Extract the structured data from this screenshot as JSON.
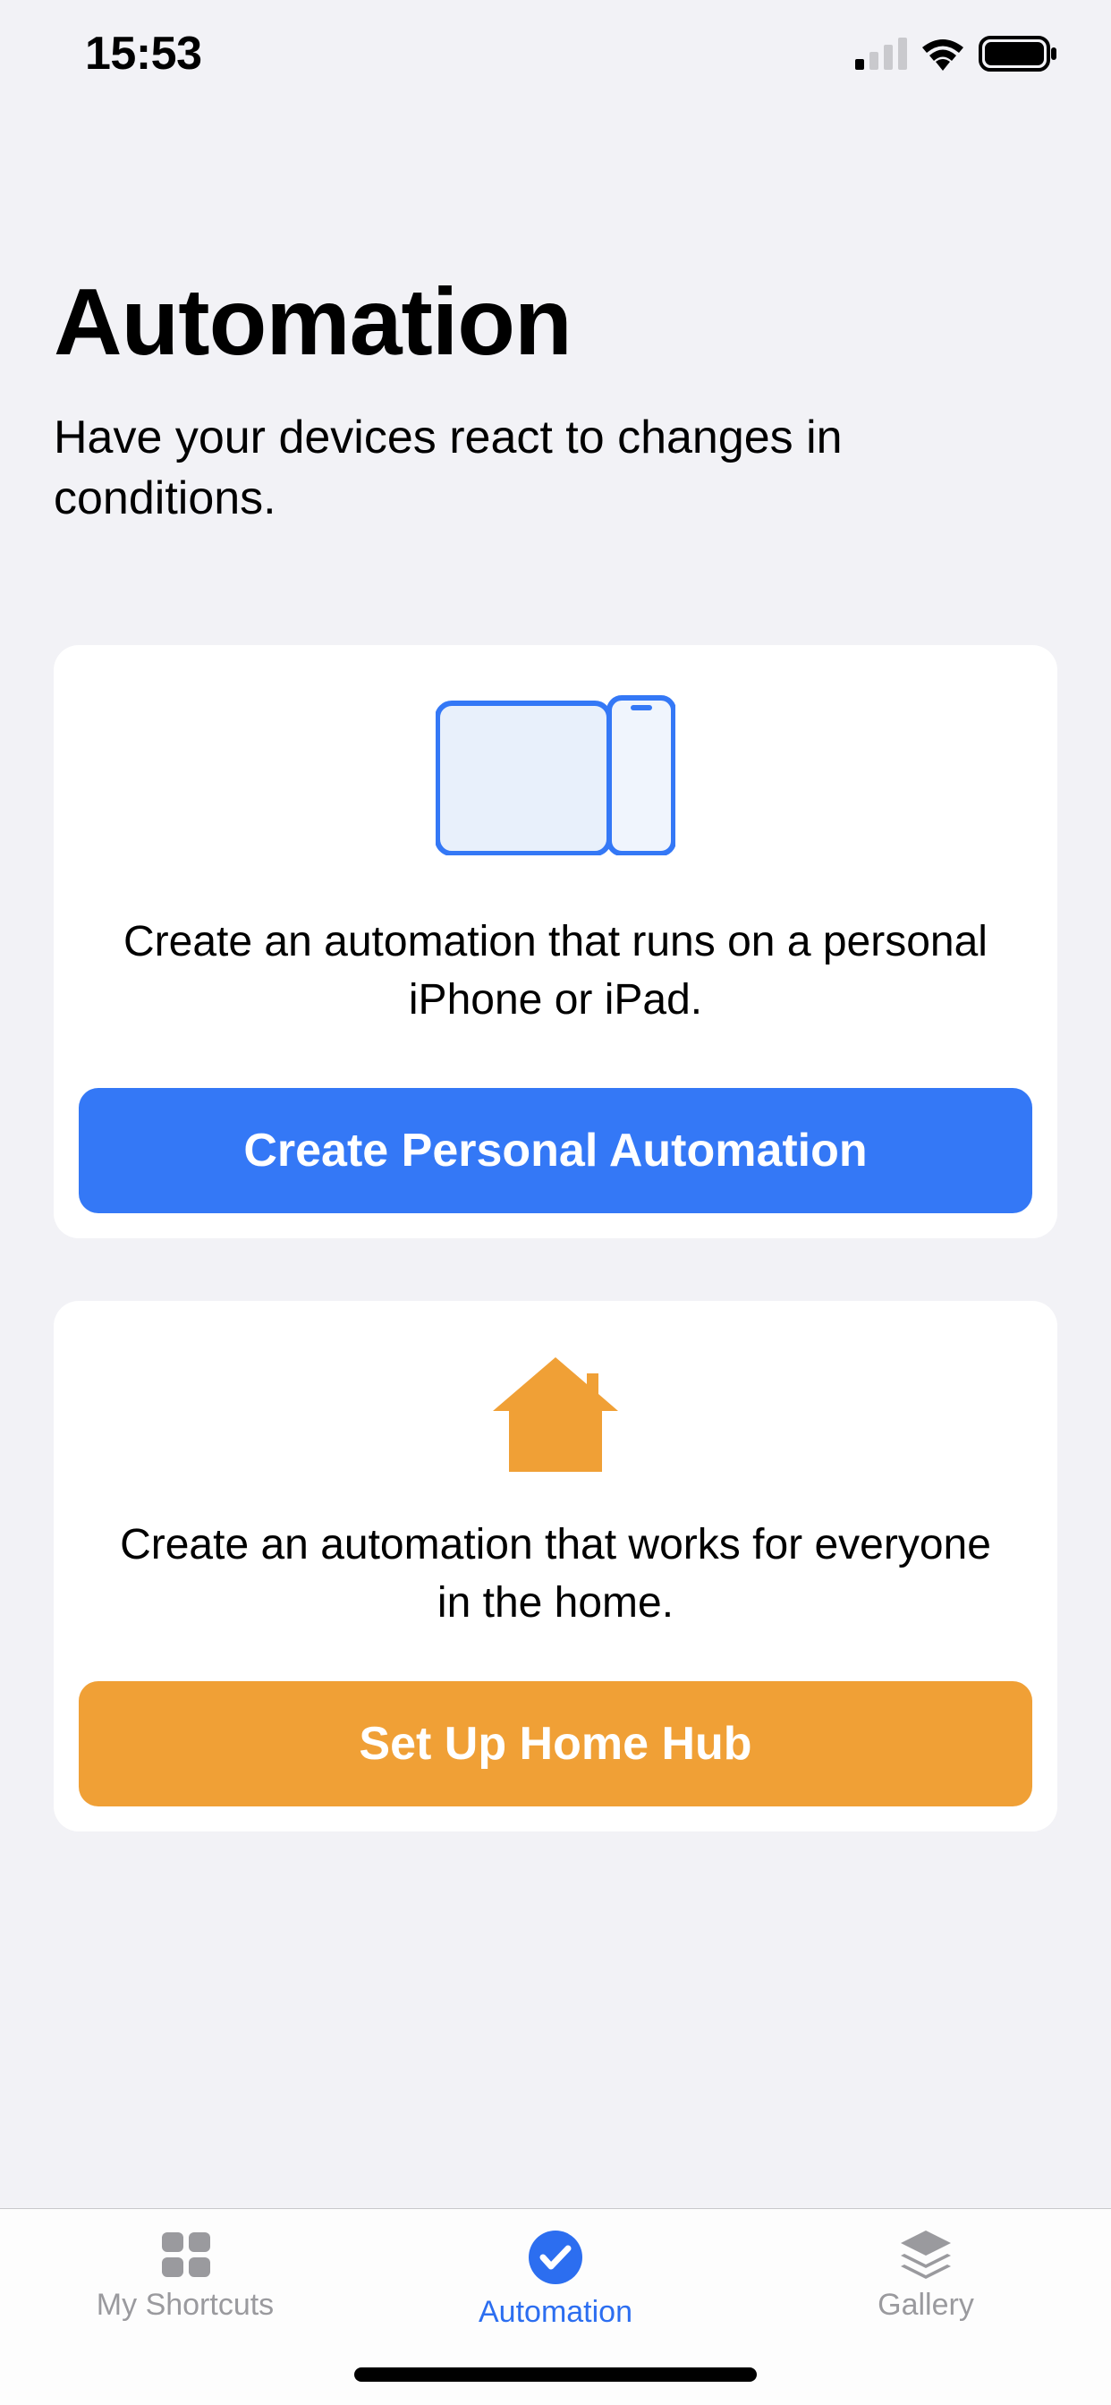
{
  "status": {
    "time": "15:53"
  },
  "header": {
    "title": "Automation",
    "subtitle": "Have your devices react to changes in conditions."
  },
  "cards": {
    "personal": {
      "text": "Create an automation that runs on a personal iPhone or iPad.",
      "button": "Create Personal Automation"
    },
    "home": {
      "text": "Create an automation that works for everyone in the home.",
      "button": "Set Up Home Hub"
    }
  },
  "tabs": {
    "shortcuts": "My Shortcuts",
    "automation": "Automation",
    "gallery": "Gallery"
  },
  "colors": {
    "blue": "#3478f6",
    "orange": "#f0a036"
  }
}
